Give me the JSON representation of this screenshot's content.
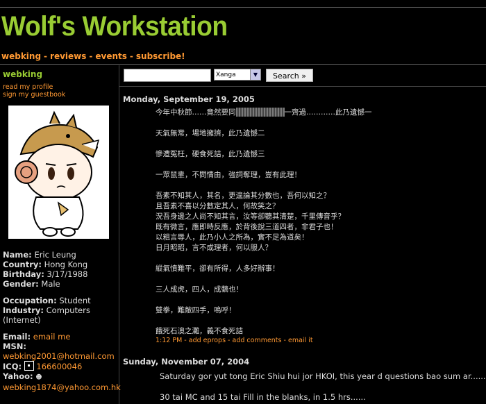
{
  "site": {
    "title": "Wolf's Workstation",
    "nav": [
      "webking",
      "reviews",
      "events",
      "subscribe!"
    ]
  },
  "sidebar": {
    "username": "webking",
    "links": [
      "read my profile",
      "sign my guestbook"
    ],
    "profile": {
      "name_label": "Name:",
      "name": "Eric Leung",
      "country_label": "Country:",
      "country": "Hong Kong",
      "birthday_label": "Birthday:",
      "birthday": "3/17/1988",
      "gender_label": "Gender:",
      "gender": "Male",
      "occupation_label": "Occupation:",
      "occupation": "Student",
      "industry_label": "Industry:",
      "industry": "Computers (Internet)",
      "email_label": "Email:",
      "email_link": "email me",
      "msn_label": "MSN:",
      "msn": "webking2001@hotmail.com",
      "icq_label": "ICQ:",
      "icq": "166600046",
      "yahoo_label": "Yahoo:",
      "yahoo": "webking1874@yahoo.com.hk"
    }
  },
  "search": {
    "input_value": "",
    "select_value": "Xanga",
    "button_label": "Search »"
  },
  "entries": [
    {
      "date": "Monday, September 19, 2005",
      "paragraphs": [
        [
          "今年中秋節……竟然要同",
          "一齊過…………此乃遺憾一"
        ],
        [
          "天氣無常，場地擁擠，此乃遺憾二"
        ],
        [
          "慘遭冤枉，硬食死詰，此乃遺憾三"
        ],
        [
          "一眾鼠輩，不問情由，強詞奪理，豈有此理！"
        ],
        [
          "吾素不知其人，其名，更遑論其分數也，吾何以知之？",
          "且吾素不喜以分數定其人，何故笑之？",
          "況吾身邊之人尚不知其言，汝等卻聽其清楚，千里傳音乎？",
          "既有微言，應即時反應，於背後說三道四者，非君子也！",
          "以粗言辱人，此乃小人之所為，實不足為道矣！",
          "日月昭昭，言不成理者，何以服人？"
        ],
        [
          "縱氣憤難平，卻有所得，人多好辦事！"
        ],
        [
          "三人成虎，四人，成黐也！"
        ],
        [
          "雙拳，難敵四手，嗚呼！"
        ],
        [
          "餓死石澳之灘，義不食死詰"
        ]
      ],
      "footer": {
        "time": "1:12 PM",
        "links": [
          "add eprops",
          "add comments",
          "email it"
        ]
      }
    },
    {
      "date": "Sunday, November 07, 2004",
      "lines": [
        "Saturday gor yut tong Eric Shiu hui jor HKOI, this year d questions bao sum ar......",
        "30 tai MC and 15 tai Fill in the blanks, in 1.5 hrs......"
      ]
    }
  ],
  "colors": {
    "accent": "#99cc33",
    "link": "#ff9933",
    "background": "#000000"
  }
}
